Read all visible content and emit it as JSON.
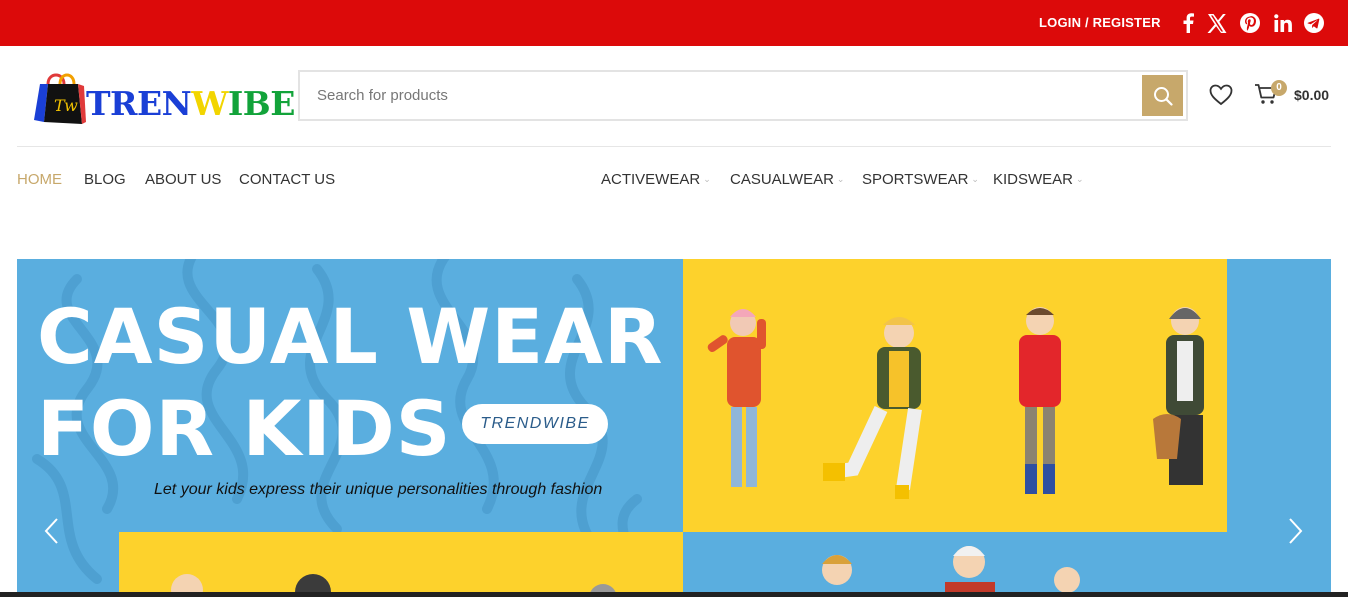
{
  "topbar": {
    "login_label": "LOGIN / REGISTER",
    "background": "#dc0a0a",
    "social_icons": [
      "facebook-icon",
      "x-twitter-icon",
      "pinterest-icon",
      "linkedin-icon",
      "telegram-icon"
    ]
  },
  "header": {
    "logo_monogram": "Tw",
    "logo_text": [
      "TREN",
      "W",
      "IBE"
    ],
    "logo_colors": [
      "#1a3fd6",
      "#f2d500",
      "#12a33a"
    ],
    "search": {
      "placeholder": "Search for products"
    },
    "cart": {
      "count": "0",
      "total": "$0.00"
    },
    "accent": "#c7a86b"
  },
  "nav": {
    "left": [
      {
        "label": "HOME",
        "active": true
      },
      {
        "label": "BLOG"
      },
      {
        "label": "ABOUT US"
      },
      {
        "label": "CONTACT US"
      }
    ],
    "right": [
      {
        "label": "ACTIVEWEAR"
      },
      {
        "label": "CASUALWEAR"
      },
      {
        "label": "SPORTSWEAR"
      },
      {
        "label": "KIDSWEAR"
      }
    ]
  },
  "hero": {
    "title_line1": "CASUAL WEAR",
    "title_line2": "FOR KIDS",
    "brand_pill": "TRENDWIBE",
    "tagline": "Let your kids express their unique personalities through fashion",
    "colors": {
      "blue": "#5aaedf",
      "yellow": "#fdd22c"
    }
  }
}
